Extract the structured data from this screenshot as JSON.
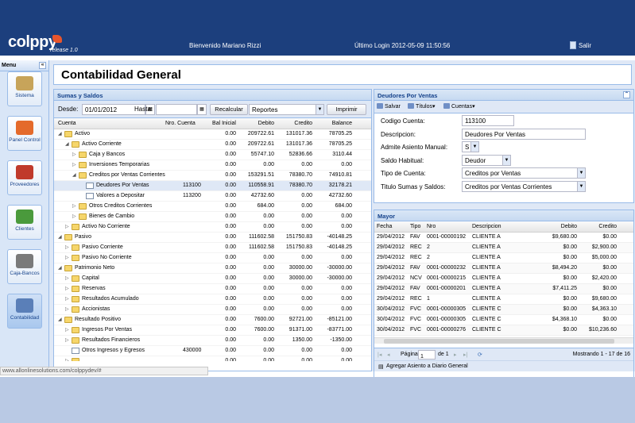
{
  "header": {
    "logo": "colppy",
    "logo_sub": "release 1.0",
    "welcome": "Bienvenido  Mariano Rizzi",
    "last_login": "Último Login   2012-05-09 11:50:56",
    "salir": "Salir"
  },
  "menu": {
    "title": "Menu",
    "collapse": "«",
    "items": [
      {
        "label": "Sistema",
        "icon": "wrench-icon",
        "color": "#c7a45a"
      },
      {
        "label": "Panel Control",
        "icon": "bar-chart-icon",
        "color": "#e46a2b"
      },
      {
        "label": "Proveedores",
        "icon": "arrow-right-icon",
        "color": "#c03a2b"
      },
      {
        "label": "Clientes",
        "icon": "arrow-left-icon",
        "color": "#4a9a3c"
      },
      {
        "label": "Caja-Bancos",
        "icon": "money-bag-icon",
        "color": "#7a7a7a"
      },
      {
        "label": "Contabilidad",
        "icon": "ledger-icon",
        "color": "#5a7fb8"
      }
    ]
  },
  "page": {
    "title": "Contabilidad General"
  },
  "sumas": {
    "title": "Sumas y Saldos",
    "desde_label": "Desde:",
    "desde_value": "01/01/2012",
    "hasta_label": "Hasta:",
    "hasta_value": "",
    "recalcular": "Recalcular",
    "reportes": "Reportes",
    "imprimir": "Imprimir",
    "columns": [
      "Cuenta",
      "Nro. Cuenta",
      "Bal Inicial",
      "Debito",
      "Credito",
      "Balance"
    ],
    "rows": [
      {
        "level": 0,
        "type": "folder",
        "open": true,
        "name": "Activo",
        "nro": "",
        "bal": "0.00",
        "deb": "209722.61",
        "cred": "131017.36",
        "balance": "78705.25"
      },
      {
        "level": 1,
        "type": "folder",
        "open": true,
        "name": "Activo Corriente",
        "nro": "",
        "bal": "0.00",
        "deb": "209722.61",
        "cred": "131017.36",
        "balance": "78705.25"
      },
      {
        "level": 2,
        "type": "folder",
        "open": false,
        "name": "Caja y Bancos",
        "nro": "",
        "bal": "0.00",
        "deb": "55747.10",
        "cred": "52836.66",
        "balance": "3110.44"
      },
      {
        "level": 2,
        "type": "folder",
        "open": false,
        "name": "Inversiones Temporarias",
        "nro": "",
        "bal": "0.00",
        "deb": "0.00",
        "cred": "0.00",
        "balance": "0.00"
      },
      {
        "level": 2,
        "type": "folder",
        "open": true,
        "name": "Creditos por Ventas Corrientes",
        "nro": "",
        "bal": "0.00",
        "deb": "153291.51",
        "cred": "78380.70",
        "balance": "74910.81"
      },
      {
        "level": 3,
        "type": "leaf",
        "name": "Deudores Por Ventas",
        "nro": "113100",
        "bal": "0.00",
        "deb": "110558.91",
        "cred": "78380.70",
        "balance": "32178.21",
        "selected": true
      },
      {
        "level": 3,
        "type": "leaf",
        "name": "Valores a Depositar",
        "nro": "113200",
        "bal": "0.00",
        "deb": "42732.60",
        "cred": "0.00",
        "balance": "42732.60"
      },
      {
        "level": 2,
        "type": "folder",
        "open": false,
        "name": "Otros Creditos Corrientes",
        "nro": "",
        "bal": "0.00",
        "deb": "684.00",
        "cred": "0.00",
        "balance": "684.00"
      },
      {
        "level": 2,
        "type": "folder",
        "open": false,
        "name": "Bienes de Cambio",
        "nro": "",
        "bal": "0.00",
        "deb": "0.00",
        "cred": "0.00",
        "balance": "0.00"
      },
      {
        "level": 1,
        "type": "folder",
        "open": false,
        "name": "Activo No Corriente",
        "nro": "",
        "bal": "0.00",
        "deb": "0.00",
        "cred": "0.00",
        "balance": "0.00"
      },
      {
        "level": 0,
        "type": "folder",
        "open": true,
        "name": "Pasivo",
        "nro": "",
        "bal": "0.00",
        "deb": "111602.58",
        "cred": "151750.83",
        "balance": "-40148.25"
      },
      {
        "level": 1,
        "type": "folder",
        "open": false,
        "name": "Pasivo Corriente",
        "nro": "",
        "bal": "0.00",
        "deb": "111602.58",
        "cred": "151750.83",
        "balance": "-40148.25"
      },
      {
        "level": 1,
        "type": "folder",
        "open": false,
        "name": "Pasivo No Corriente",
        "nro": "",
        "bal": "0.00",
        "deb": "0.00",
        "cred": "0.00",
        "balance": "0.00"
      },
      {
        "level": 0,
        "type": "folder",
        "open": true,
        "name": "Patrimonio Neto",
        "nro": "",
        "bal": "0.00",
        "deb": "0.00",
        "cred": "30000.00",
        "balance": "-30000.00"
      },
      {
        "level": 1,
        "type": "folder",
        "open": false,
        "name": "Capital",
        "nro": "",
        "bal": "0.00",
        "deb": "0.00",
        "cred": "30000.00",
        "balance": "-30000.00"
      },
      {
        "level": 1,
        "type": "folder",
        "open": false,
        "name": "Reservas",
        "nro": "",
        "bal": "0.00",
        "deb": "0.00",
        "cred": "0.00",
        "balance": "0.00"
      },
      {
        "level": 1,
        "type": "folder",
        "open": false,
        "name": "Resultados Acumulado",
        "nro": "",
        "bal": "0.00",
        "deb": "0.00",
        "cred": "0.00",
        "balance": "0.00"
      },
      {
        "level": 1,
        "type": "folder",
        "open": false,
        "name": "Accionistas",
        "nro": "",
        "bal": "0.00",
        "deb": "0.00",
        "cred": "0.00",
        "balance": "0.00"
      },
      {
        "level": 0,
        "type": "folder",
        "open": true,
        "name": "Resultado Positivo",
        "nro": "",
        "bal": "0.00",
        "deb": "7600.00",
        "cred": "92721.00",
        "balance": "-85121.00"
      },
      {
        "level": 1,
        "type": "folder",
        "open": false,
        "name": "Ingresos Por Ventas",
        "nro": "",
        "bal": "0.00",
        "deb": "7600.00",
        "cred": "91371.00",
        "balance": "-83771.00"
      },
      {
        "level": 1,
        "type": "folder",
        "open": false,
        "name": "Resultados Financieros",
        "nro": "",
        "bal": "0.00",
        "deb": "0.00",
        "cred": "1350.00",
        "balance": "-1350.00"
      },
      {
        "level": 1,
        "type": "leaf",
        "name": "Otros Ingresos y Egresos",
        "nro": "430000",
        "bal": "0.00",
        "deb": "0.00",
        "cred": "0.00",
        "balance": "0.00"
      },
      {
        "level": 1,
        "type": "folder",
        "open": false,
        "name": "",
        "nro": "",
        "bal": "0.00",
        "deb": "0.00",
        "cred": "0.00",
        "balance": "0.00"
      }
    ]
  },
  "deudores": {
    "title": "Deudores Por Ventas",
    "salvar": "Salvar",
    "titulos": "Títulos",
    "cuentas": "Cuentas",
    "fields": [
      {
        "label": "Codigo Cuenta:",
        "value": "113100",
        "select": false
      },
      {
        "label": "Descripcion:",
        "value": "Deudores Por Ventas",
        "select": false
      },
      {
        "label": "Admite Asiento Manual:",
        "value": "S",
        "select": true
      },
      {
        "label": "Saldo Habitual:",
        "value": "Deudor",
        "select": true
      },
      {
        "label": "Tipo de Cuenta:",
        "value": "Creditos por Ventas",
        "select": true
      },
      {
        "label": "Titulo Sumas y Saldos:",
        "value": "Creditos por Ventas Corrientes",
        "select": true
      }
    ]
  },
  "mayor": {
    "title": "Mayor",
    "columns": [
      "Fecha",
      "Tipo",
      "Nro",
      "Descripcion",
      "Debito",
      "Credito"
    ],
    "rows": [
      [
        "29/04/2012",
        "FAV",
        "0001-00000192",
        "CLIENTE A",
        "$9,680.00",
        "$0.00"
      ],
      [
        "29/04/2012",
        "REC",
        "2",
        "CLIENTE A",
        "$0.00",
        "$2,900.00"
      ],
      [
        "29/04/2012",
        "REC",
        "2",
        "CLIENTE A",
        "$0.00",
        "$5,000.00"
      ],
      [
        "29/04/2012",
        "FAV",
        "0001-00000232",
        "CLIENTE A",
        "$8,494.20",
        "$0.00"
      ],
      [
        "29/04/2012",
        "NCV",
        "0001-00000215",
        "CLIENTE A",
        "$0.00",
        "$2,420.00"
      ],
      [
        "29/04/2012",
        "FAV",
        "0001-00000201",
        "CLIENTE A",
        "$7,411.25",
        "$0.00"
      ],
      [
        "29/04/2012",
        "REC",
        "1",
        "CLIENTE A",
        "$0.00",
        "$9,680.00"
      ],
      [
        "30/04/2012",
        "FVC",
        "0001-00000305",
        "CLIENTE C",
        "$0.00",
        "$4,363.10"
      ],
      [
        "30/04/2012",
        "FVC",
        "0001-00000305",
        "CLIENTE C",
        "$4,368.10",
        "$0.00"
      ],
      [
        "30/04/2012",
        "FVC",
        "0001-00000276",
        "CLIENTE C",
        "$0.00",
        "$10,236.60"
      ]
    ],
    "pagina_label": "Página",
    "pagina_value": "1",
    "de": "de 1",
    "mostrando": "Mostrando 1 - 17 de 16",
    "agregar": "Agregar Asiento a Diario General"
  },
  "status": {
    "url": "www.allonlinesolutions.com/colppydev/#"
  }
}
